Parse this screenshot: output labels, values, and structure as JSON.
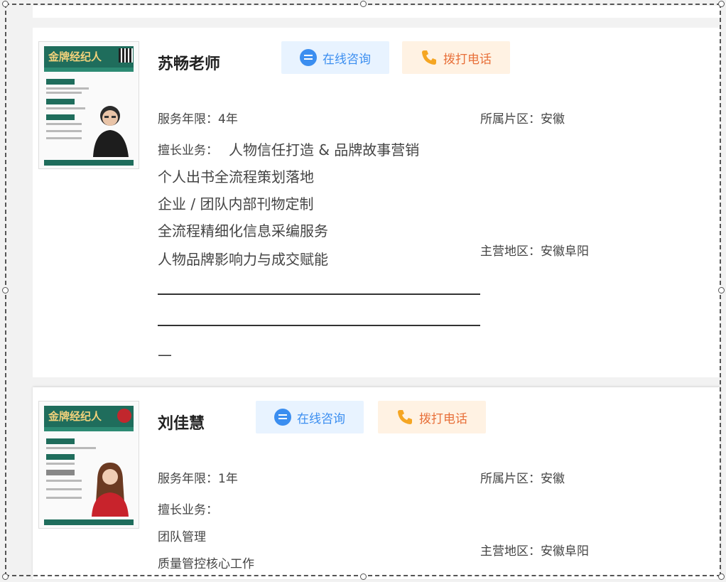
{
  "cards": [
    {
      "name": "苏畅老师",
      "chat_label": "在线咨询",
      "call_label": "拨打电话",
      "service_years": "服务年限：4年",
      "region": "所属片区：安徽",
      "expertise_label": "擅长业务：",
      "expertise_items": [
        "人物信任打造 & 品牌故事营销",
        "个人出书全流程策划落地",
        "企业 / 团队内部刊物定制",
        "全流程精细化信息采编服务",
        "人物品牌影响力与成交赋能"
      ],
      "main_area": "主营地区：安徽阜阳",
      "dash_tail": "—",
      "poster_title": "金牌经纪人"
    },
    {
      "name": "刘佳慧",
      "chat_label": "在线咨询",
      "call_label": "拨打电话",
      "service_years": "服务年限：1年",
      "region": "所属片区：安徽",
      "expertise_label": "擅长业务：",
      "expertise_items": [
        "团队管理",
        "质量管控核心工作"
      ],
      "main_area": "主营地区：安徽阜阳",
      "poster_title": "金牌经纪人"
    }
  ],
  "icons": {
    "chat": "chat-bubble-icon",
    "phone": "phone-icon"
  },
  "colors": {
    "chat_bg": "#e8f3ff",
    "chat_text": "#3b8ef0",
    "call_bg": "#fff2e3",
    "call_text": "#e8703a",
    "phone_icon": "#f5a623"
  }
}
